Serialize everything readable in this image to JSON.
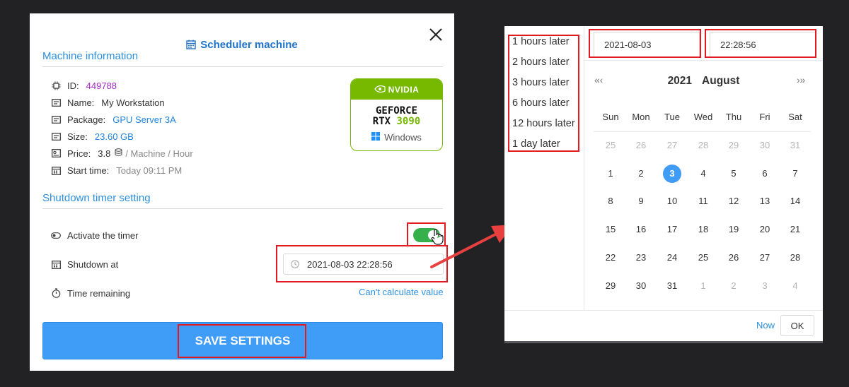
{
  "dialog": {
    "title": "Scheduler machine",
    "machine_section": "Machine information",
    "id_label": "ID:",
    "id_value": "449788",
    "name_label": "Name:",
    "name_value": "My Workstation",
    "package_label": "Package:",
    "package_value": "GPU Server 3A",
    "size_label": "Size:",
    "size_value": "23.60 GB",
    "price_label": "Price:",
    "price_value": "3.8",
    "price_unit": "/ Machine / Hour",
    "start_label": "Start time:",
    "start_value": "Today 09:11 PM",
    "gpu": {
      "brand": "NVIDIA",
      "model_line1": "GEFORCE",
      "model_line2a": "RTX ",
      "model_line2b": "3090",
      "os": "Windows"
    },
    "shutdown_section": "Shutdown timer setting",
    "activate_label": "Activate the timer",
    "activate_on": true,
    "shutdown_label": "Shutdown at",
    "shutdown_value": "2021-08-03 22:28:56",
    "remaining_label": "Time remaining",
    "remaining_value": "Can't calculate value",
    "save_label": "SAVE SETTINGS"
  },
  "picker": {
    "presets": [
      "1 hours later",
      "2 hours later",
      "3 hours later",
      "6 hours later",
      "12 hours later",
      "1 day later"
    ],
    "date_value": "2021-08-03",
    "time_value": "22:28:56",
    "year": "2021",
    "month": "August",
    "prev_label": "« ‹",
    "next_label": "› »",
    "weekdays": [
      "Sun",
      "Mon",
      "Tue",
      "Wed",
      "Thu",
      "Fri",
      "Sat"
    ],
    "weeks": [
      [
        25,
        26,
        27,
        28,
        29,
        30,
        31
      ],
      [
        1,
        2,
        3,
        4,
        5,
        6,
        7
      ],
      [
        8,
        9,
        10,
        11,
        12,
        13,
        14
      ],
      [
        15,
        16,
        17,
        18,
        19,
        20,
        21
      ],
      [
        22,
        23,
        24,
        25,
        26,
        27,
        28
      ],
      [
        29,
        30,
        31,
        1,
        2,
        3,
        4
      ]
    ],
    "selected_day": 3,
    "now_label": "Now",
    "ok_label": "OK"
  },
  "colors": {
    "accent_blue": "#3f9cf7",
    "highlight_red": "#e21b22",
    "nvidia_green": "#76b900",
    "toggle_green": "#35b04a"
  }
}
